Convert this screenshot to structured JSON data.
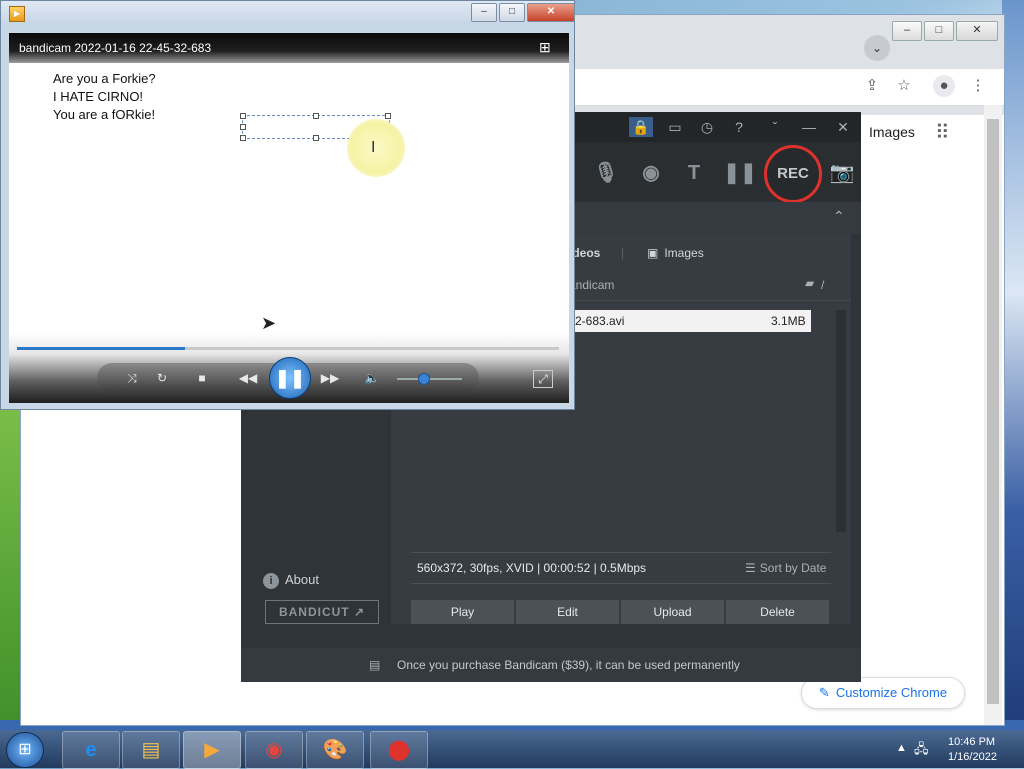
{
  "chrome": {
    "images_link": "Images",
    "customize_label": "Customize Chrome",
    "controls": {
      "minimize": "–",
      "maximize": "□",
      "close": "✕"
    }
  },
  "bandicam": {
    "tabs": {
      "videos": "ideos",
      "images": "Images"
    },
    "path": "andicam",
    "path_suffix": "/",
    "file": {
      "name": "2-683.avi",
      "size": "3.1MB"
    },
    "info": "560x372, 30fps, XVID | 00:00:52 | 0.5Mbps",
    "sort_label": "Sort by Date",
    "buttons": {
      "play": "Play",
      "edit": "Edit",
      "upload": "Upload",
      "delete": "Delete"
    },
    "sidebar": {
      "about": "About",
      "bandicut": "BANDICUT ↗"
    },
    "rec_label": "REC",
    "footer": "Once you purchase Bandicam ($39), it can be used permanently"
  },
  "player": {
    "title": "bandicam 2022-01-16 22-45-32-683",
    "lines": [
      "Are you a Forkie?",
      "I HATE CIRNO!",
      "You are a fORkie!"
    ],
    "seek_progress": 0.31,
    "volume_level": 0.4
  },
  "taskbar": {
    "time": "10:46 PM",
    "date": "1/16/2022"
  }
}
